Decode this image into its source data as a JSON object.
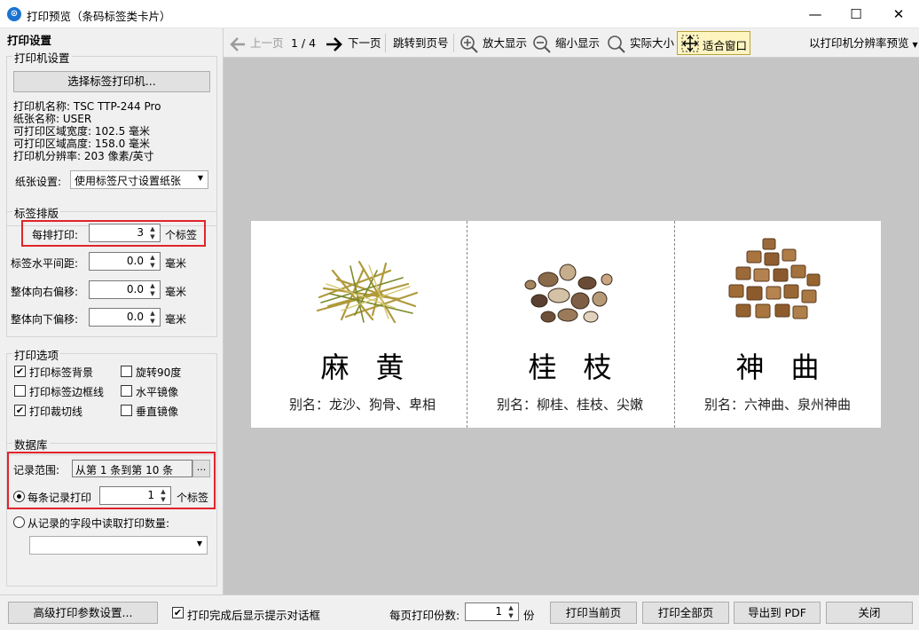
{
  "window": {
    "title": "打印预览（条码标签类卡片）",
    "icon_letter": "⊙",
    "minimize": "—",
    "maximize": "☐",
    "close": "✕"
  },
  "panel": {
    "title": "打印设置",
    "printer_group": {
      "title": "打印机设置",
      "select_button": "选择标签打印机...",
      "info": [
        "打印机名称: TSC TTP-244 Pro",
        "纸张名称: USER",
        "可打印区域宽度: 102.5 毫米",
        "可打印区域高度: 158.0 毫米",
        "打印机分辨率: 203 像素/英寸"
      ],
      "paper_label": "纸张设置:",
      "paper_value": "使用标签尺寸设置纸张"
    },
    "layout_group": {
      "title": "标签排版",
      "per_row_label": "每排打印:",
      "per_row_value": "3",
      "per_row_unit": "个标签",
      "h_gap_label": "标签水平间距:",
      "h_gap_value": "0.0",
      "right_offset_label": "整体向右偏移:",
      "right_offset_value": "0.0",
      "down_offset_label": "整体向下偏移:",
      "down_offset_value": "0.0",
      "unit_mm": "毫米"
    },
    "options_group": {
      "title": "打印选项",
      "print_bg": "打印标签背景",
      "print_border": "打印标签边框线",
      "print_cut": "打印裁切线",
      "rotate90": "旋转90度",
      "h_mirror": "水平镜像",
      "v_mirror": "垂直镜像",
      "check_mark": "✔"
    },
    "db_group": {
      "title": "数据库",
      "range_label": "记录范围:",
      "range_value": "从第 1 条到第 10 条",
      "range_button": "...",
      "each_record_label": "每条记录打印",
      "each_record_value": "1",
      "each_record_unit": "个标签",
      "from_field_label": "从记录的字段中读取打印数量:"
    }
  },
  "toolbar": {
    "prev": "上一页",
    "page_indicator": "1 / 4",
    "next": "下一页",
    "jump": "跳转到页号",
    "zoom_in": "放大显示",
    "zoom_out": "缩小显示",
    "actual_size": "实际大小",
    "fit_window": "适合窗口",
    "resolution_preview": "以打印机分辨率预览"
  },
  "cards": [
    {
      "name": "麻黄",
      "alias": "别名：龙沙、狗骨、卑相"
    },
    {
      "name": "桂枝",
      "alias": "别名：柳桂、桂枝、尖嫩"
    },
    {
      "name": "神曲",
      "alias": "别名：六神曲、泉州神曲"
    }
  ],
  "bottom": {
    "advanced_button": "高级打印参数设置...",
    "show_dialog_label": "打印完成后显示提示对话框",
    "copies_label": "每页打印份数:",
    "copies_value": "1",
    "copies_unit": "份",
    "print_current": "打印当前页",
    "print_all": "打印全部页",
    "export_pdf": "导出到 PDF",
    "close": "关闭"
  },
  "colors": {
    "accent_red": "#e0242a",
    "preview_bg": "#c5c5c5"
  }
}
